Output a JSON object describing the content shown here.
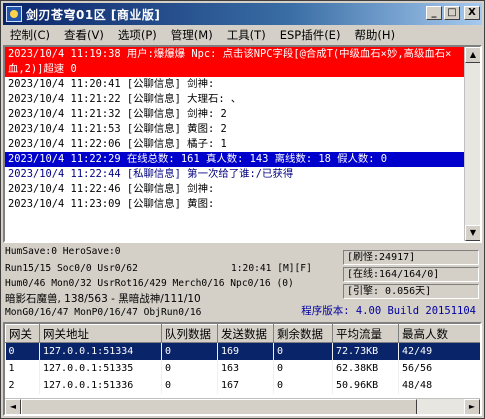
{
  "window": {
    "title": "剑刃苍穹01区 [商业版]"
  },
  "title_buttons": {
    "minimize": "_",
    "maximize": "□",
    "close": "X"
  },
  "menu": [
    "控制(C)",
    "查看(V)",
    "选项(P)",
    "管理(M)",
    "工具(T)",
    "ESP插件(E)",
    "帮助(H)"
  ],
  "log": [
    {
      "style": "red",
      "text": "2023/10/4 11:19:38 用户:爆爆爆 Npc:   点击该NPC字段[@合成T(中级血石×妙,高级血石×血,2)]超速 0"
    },
    {
      "style": "normal",
      "text": "2023/10/4 11:20:41 [公聊信息] 剑神:"
    },
    {
      "style": "normal",
      "text": "2023/10/4 11:21:22 [公聊信息] 大理石: 、"
    },
    {
      "style": "normal",
      "text": "2023/10/4 11:21:32 [公聊信息] 剑神: 2"
    },
    {
      "style": "normal",
      "text": "2023/10/4 11:21:53 [公聊信息] 黄图: 2"
    },
    {
      "style": "normal",
      "text": "2023/10/4 11:22:06 [公聊信息] 橘子: 1"
    },
    {
      "style": "blue",
      "text": "2023/10/4 11:22:29 在线总数: 161 真人数: 143 离线数: 18 假人数: 0"
    },
    {
      "style": "navy",
      "text": "2023/10/4 11:22:44 [私聊信息] 第一次给了谁:/已获得"
    },
    {
      "style": "normal",
      "text": "2023/10/4 11:22:46 [公聊信息] 剑神:"
    },
    {
      "style": "normal",
      "text": "2023/10/4 11:23:09 [公聊信息] 黄图:"
    }
  ],
  "scroll": {
    "up": "▲",
    "down": "▼",
    "left": "◄",
    "right": "►"
  },
  "status": {
    "humsave": "HumSave:0 HeroSave:0",
    "run": "Run15/15 Soc0/0 Usr0/62",
    "clock": "1:20:41 [M][F]",
    "hum": "Hum0/46 Mon0/32 UsrRot16/429 Merch0/16 Npc0/16 (0)",
    "map": "暗影石魔兽, 138/563 - 黑暗战神/111/10",
    "mon": "MonG0/16/47 MonP0/16/47 ObjRun0/16",
    "refresh": "[刷怪:24917]",
    "online": "[在线:164/164/0]",
    "engine": "[引擎: 0.056天]",
    "version": "程序版本: 4.00 Build 20151104"
  },
  "table": {
    "headers": [
      "网关",
      "网关地址",
      "队列数据",
      "发送数据",
      "剩余数据",
      "平均流量",
      "最高人数"
    ],
    "rows": [
      [
        "0",
        "127.0.0.1:51334",
        "0",
        "169",
        "0",
        "72.73KB",
        "42/49"
      ],
      [
        "1",
        "127.0.0.1:51335",
        "0",
        "163",
        "0",
        "62.38KB",
        "56/56"
      ],
      [
        "2",
        "127.0.0.1:51336",
        "0",
        "167",
        "0",
        "50.96KB",
        "48/48"
      ]
    ],
    "selected_row": 0
  }
}
